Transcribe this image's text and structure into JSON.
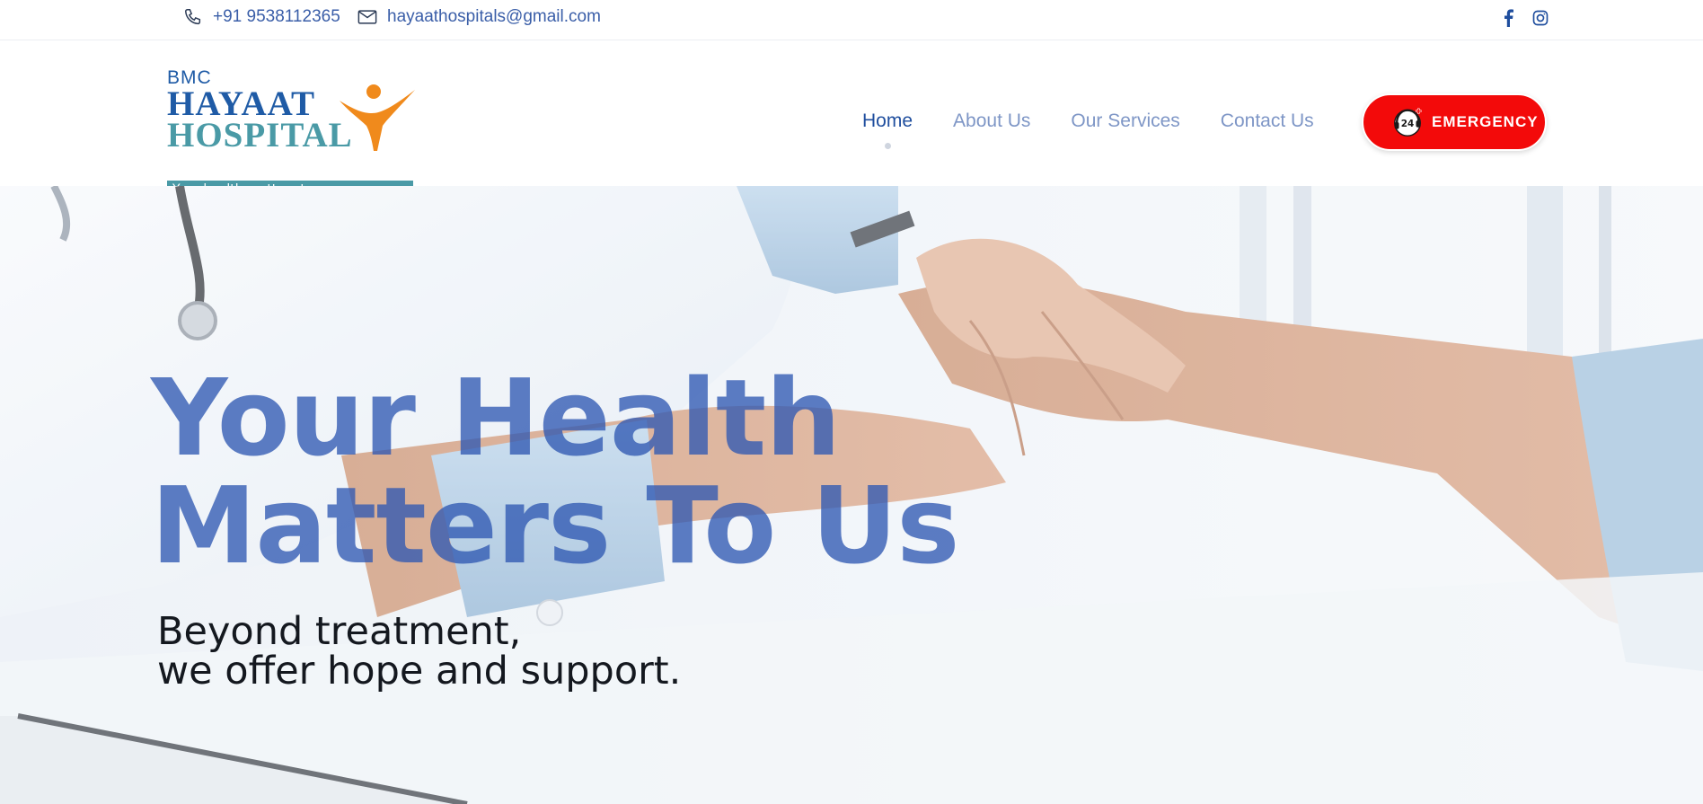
{
  "topbar": {
    "phone": "+91 9538112365",
    "email": "hayaathospitals@gmail.com",
    "phone_icon": "phone-icon",
    "email_icon": "mail-icon",
    "social": [
      "facebook-icon",
      "instagram-icon"
    ]
  },
  "logo": {
    "bmc": "BMC",
    "line1": "HAYAAT",
    "line2": "HOSPITAL",
    "tagline": "Your health matters to us"
  },
  "nav": {
    "items": [
      {
        "label": "Home",
        "active": true
      },
      {
        "label": "About Us",
        "active": false
      },
      {
        "label": "Our Services",
        "active": false
      },
      {
        "label": "Contact Us",
        "active": false
      }
    ]
  },
  "emergency": {
    "label": "EMERGENCY",
    "icon": "24-hour-support-icon",
    "badge": "24"
  },
  "hero": {
    "title_line1": "Your Health",
    "title_line2": "Matters To Us",
    "subtitle_line1": "Beyond treatment,",
    "subtitle_line2": "we offer hope and support."
  },
  "colors": {
    "brand_blue": "#1f5ba6",
    "brand_teal": "#4a9aa6",
    "logo_orange": "#f08a1c",
    "emergency_red": "#f30a0a",
    "nav_active": "#1f4e9e",
    "nav_inactive": "#7e96c6",
    "hero_title": "#2f58b2"
  }
}
